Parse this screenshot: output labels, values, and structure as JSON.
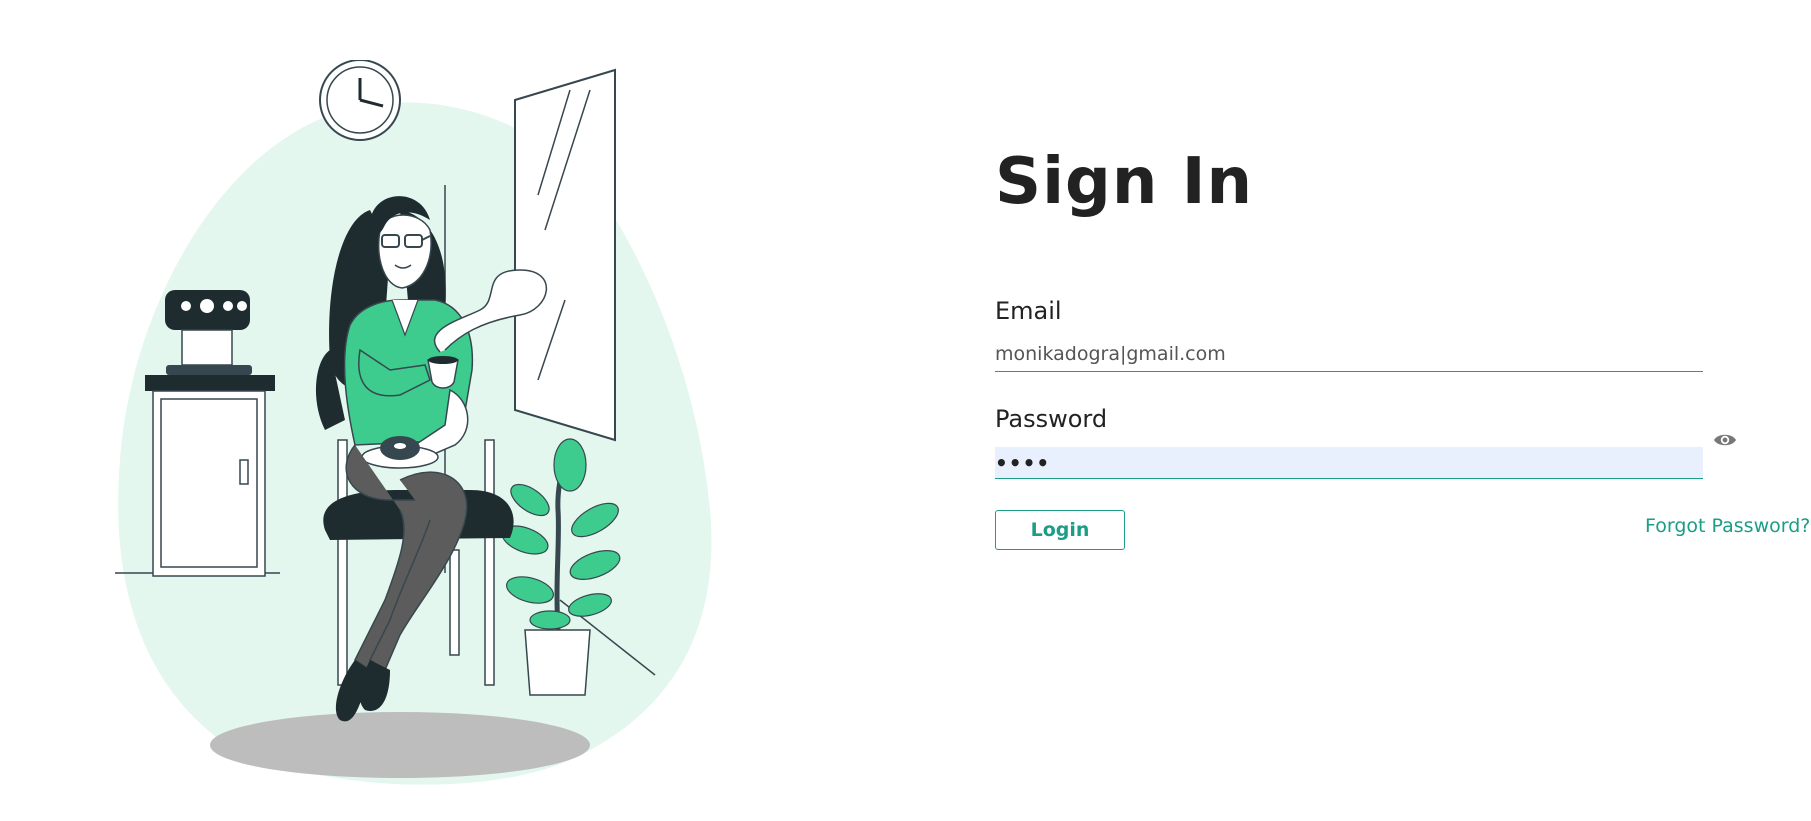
{
  "signin": {
    "title": "Sign In",
    "email_label": "Email",
    "email_value": "monikadogra|gmail.com",
    "password_label": "Password",
    "password_value": "••••",
    "login_label": "Login",
    "forgot_label": "Forgot Password?"
  },
  "colors": {
    "accent": "#1b9d86",
    "blob": "#e3f7ee",
    "green": "#3dcc8e",
    "dark": "#1e2c2f",
    "autofill_bg": "#e8f0fe"
  },
  "icons": {
    "password_toggle": "eye-icon"
  }
}
